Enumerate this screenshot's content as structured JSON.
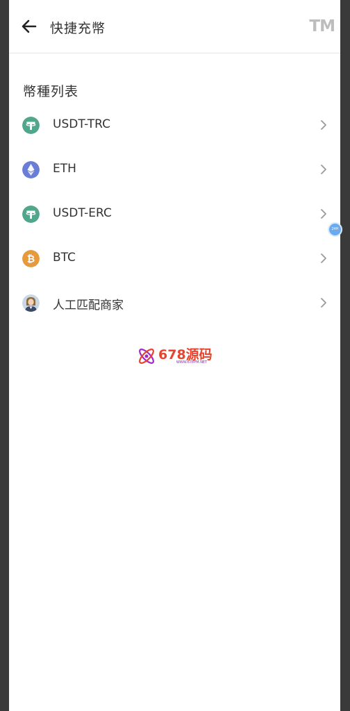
{
  "header": {
    "title": "快捷充幣",
    "logo_text": "TM",
    "back_icon": "arrow-left-icon"
  },
  "section": {
    "title": "幣種列表"
  },
  "currencies": [
    {
      "label": "USDT-TRC",
      "icon": "tether-icon",
      "color": "#50a78b"
    },
    {
      "label": "ETH",
      "icon": "ethereum-icon",
      "color": "#6a7ed8"
    },
    {
      "label": "USDT-ERC",
      "icon": "tether-icon",
      "color": "#50a78b"
    },
    {
      "label": "BTC",
      "icon": "bitcoin-icon",
      "color": "#e69a3c"
    },
    {
      "label": "人工匹配商家",
      "icon": "agent-avatar-icon",
      "color": "#c9d6e6"
    }
  ],
  "float_badge": {
    "text": "24H"
  },
  "watermark": {
    "brand": "678源码",
    "url": "WWW.678YM.NET"
  },
  "colors": {
    "background_outer": "#3a3a3a",
    "text_primary": "#333333",
    "chevron": "#9a9a9a",
    "watermark_red": "#e8432f",
    "watermark_purple": "#a02ac8"
  }
}
